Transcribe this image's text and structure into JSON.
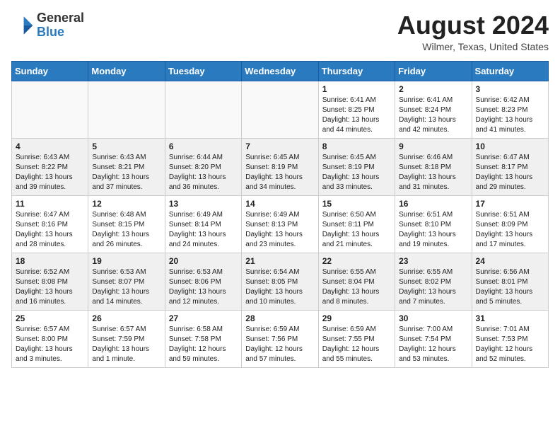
{
  "header": {
    "logo_general": "General",
    "logo_blue": "Blue",
    "month_title": "August 2024",
    "location": "Wilmer, Texas, United States"
  },
  "weekdays": [
    "Sunday",
    "Monday",
    "Tuesday",
    "Wednesday",
    "Thursday",
    "Friday",
    "Saturday"
  ],
  "weeks": [
    [
      {
        "day": "",
        "info": ""
      },
      {
        "day": "",
        "info": ""
      },
      {
        "day": "",
        "info": ""
      },
      {
        "day": "",
        "info": ""
      },
      {
        "day": "1",
        "info": "Sunrise: 6:41 AM\nSunset: 8:25 PM\nDaylight: 13 hours\nand 44 minutes."
      },
      {
        "day": "2",
        "info": "Sunrise: 6:41 AM\nSunset: 8:24 PM\nDaylight: 13 hours\nand 42 minutes."
      },
      {
        "day": "3",
        "info": "Sunrise: 6:42 AM\nSunset: 8:23 PM\nDaylight: 13 hours\nand 41 minutes."
      }
    ],
    [
      {
        "day": "4",
        "info": "Sunrise: 6:43 AM\nSunset: 8:22 PM\nDaylight: 13 hours\nand 39 minutes."
      },
      {
        "day": "5",
        "info": "Sunrise: 6:43 AM\nSunset: 8:21 PM\nDaylight: 13 hours\nand 37 minutes."
      },
      {
        "day": "6",
        "info": "Sunrise: 6:44 AM\nSunset: 8:20 PM\nDaylight: 13 hours\nand 36 minutes."
      },
      {
        "day": "7",
        "info": "Sunrise: 6:45 AM\nSunset: 8:19 PM\nDaylight: 13 hours\nand 34 minutes."
      },
      {
        "day": "8",
        "info": "Sunrise: 6:45 AM\nSunset: 8:19 PM\nDaylight: 13 hours\nand 33 minutes."
      },
      {
        "day": "9",
        "info": "Sunrise: 6:46 AM\nSunset: 8:18 PM\nDaylight: 13 hours\nand 31 minutes."
      },
      {
        "day": "10",
        "info": "Sunrise: 6:47 AM\nSunset: 8:17 PM\nDaylight: 13 hours\nand 29 minutes."
      }
    ],
    [
      {
        "day": "11",
        "info": "Sunrise: 6:47 AM\nSunset: 8:16 PM\nDaylight: 13 hours\nand 28 minutes."
      },
      {
        "day": "12",
        "info": "Sunrise: 6:48 AM\nSunset: 8:15 PM\nDaylight: 13 hours\nand 26 minutes."
      },
      {
        "day": "13",
        "info": "Sunrise: 6:49 AM\nSunset: 8:14 PM\nDaylight: 13 hours\nand 24 minutes."
      },
      {
        "day": "14",
        "info": "Sunrise: 6:49 AM\nSunset: 8:13 PM\nDaylight: 13 hours\nand 23 minutes."
      },
      {
        "day": "15",
        "info": "Sunrise: 6:50 AM\nSunset: 8:11 PM\nDaylight: 13 hours\nand 21 minutes."
      },
      {
        "day": "16",
        "info": "Sunrise: 6:51 AM\nSunset: 8:10 PM\nDaylight: 13 hours\nand 19 minutes."
      },
      {
        "day": "17",
        "info": "Sunrise: 6:51 AM\nSunset: 8:09 PM\nDaylight: 13 hours\nand 17 minutes."
      }
    ],
    [
      {
        "day": "18",
        "info": "Sunrise: 6:52 AM\nSunset: 8:08 PM\nDaylight: 13 hours\nand 16 minutes."
      },
      {
        "day": "19",
        "info": "Sunrise: 6:53 AM\nSunset: 8:07 PM\nDaylight: 13 hours\nand 14 minutes."
      },
      {
        "day": "20",
        "info": "Sunrise: 6:53 AM\nSunset: 8:06 PM\nDaylight: 13 hours\nand 12 minutes."
      },
      {
        "day": "21",
        "info": "Sunrise: 6:54 AM\nSunset: 8:05 PM\nDaylight: 13 hours\nand 10 minutes."
      },
      {
        "day": "22",
        "info": "Sunrise: 6:55 AM\nSunset: 8:04 PM\nDaylight: 13 hours\nand 8 minutes."
      },
      {
        "day": "23",
        "info": "Sunrise: 6:55 AM\nSunset: 8:02 PM\nDaylight: 13 hours\nand 7 minutes."
      },
      {
        "day": "24",
        "info": "Sunrise: 6:56 AM\nSunset: 8:01 PM\nDaylight: 13 hours\nand 5 minutes."
      }
    ],
    [
      {
        "day": "25",
        "info": "Sunrise: 6:57 AM\nSunset: 8:00 PM\nDaylight: 13 hours\nand 3 minutes."
      },
      {
        "day": "26",
        "info": "Sunrise: 6:57 AM\nSunset: 7:59 PM\nDaylight: 13 hours\nand 1 minute."
      },
      {
        "day": "27",
        "info": "Sunrise: 6:58 AM\nSunset: 7:58 PM\nDaylight: 12 hours\nand 59 minutes."
      },
      {
        "day": "28",
        "info": "Sunrise: 6:59 AM\nSunset: 7:56 PM\nDaylight: 12 hours\nand 57 minutes."
      },
      {
        "day": "29",
        "info": "Sunrise: 6:59 AM\nSunset: 7:55 PM\nDaylight: 12 hours\nand 55 minutes."
      },
      {
        "day": "30",
        "info": "Sunrise: 7:00 AM\nSunset: 7:54 PM\nDaylight: 12 hours\nand 53 minutes."
      },
      {
        "day": "31",
        "info": "Sunrise: 7:01 AM\nSunset: 7:53 PM\nDaylight: 12 hours\nand 52 minutes."
      }
    ]
  ]
}
